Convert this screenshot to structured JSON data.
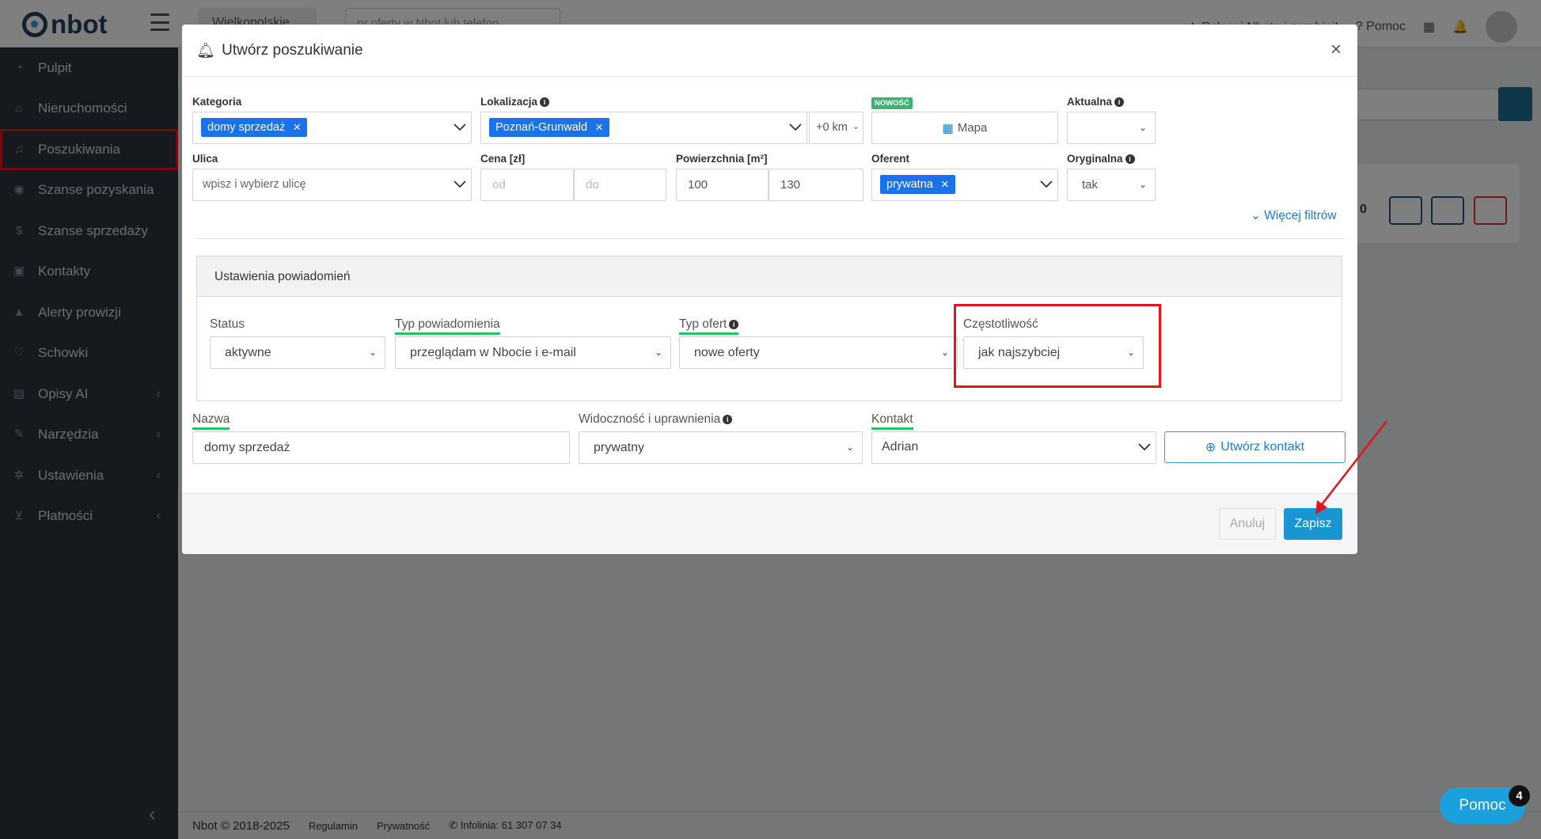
{
  "topbar": {
    "logo": "nbot",
    "region": "Wielkopolskie",
    "search_placeholder": "nr oferty w Nbot lub telefon",
    "referral": "Polecaj Nbota i zarabiaj!",
    "help": "Pomoc"
  },
  "sidebar": {
    "items": [
      {
        "label": "Pulpit",
        "icon": "dashboard-icon"
      },
      {
        "label": "Nieruchomości",
        "icon": "home-icon"
      },
      {
        "label": "Poszukiwania",
        "icon": "bell-icon"
      },
      {
        "label": "Szanse pozyskania",
        "icon": "eye-icon"
      },
      {
        "label": "Szanse sprzedaży",
        "icon": "dollar-icon"
      },
      {
        "label": "Kontakty",
        "icon": "contact-icon"
      },
      {
        "label": "Alerty prowizji",
        "icon": "warning-icon"
      },
      {
        "label": "Schowki",
        "icon": "heart-icon"
      },
      {
        "label": "Opisy AI",
        "icon": "comment-icon"
      },
      {
        "label": "Narzędzia",
        "icon": "wrench-icon"
      },
      {
        "label": "Ustawienia",
        "icon": "gear-icon"
      },
      {
        "label": "Płatności",
        "icon": "cart-icon"
      }
    ]
  },
  "modal": {
    "title": "Utwórz poszukiwanie",
    "filters": {
      "kategoria_label": "Kategoria",
      "kategoria_tag": "domy sprzedaż",
      "lokalizacja_label": "Lokalizacja",
      "lokalizacja_tag": "Poznań-Grunwald",
      "radius": "+0 km",
      "new_badge": "NOWOŚĆ",
      "map_button": "Mapa",
      "aktualna_label": "Aktualna",
      "ulica_label": "Ulica",
      "ulica_placeholder": "wpisz i wybierz ulicę",
      "cena_label": "Cena [zł]",
      "cena_od": "od",
      "cena_do": "do",
      "powierzchnia_label": "Powierzchnia [m²]",
      "powierzchnia_od": "100",
      "powierzchnia_do": "130",
      "oferent_label": "Oferent",
      "oferent_tag": "prywatna",
      "oryginalna_label": "Oryginalna",
      "oryginalna_value": "tak",
      "more_filters": "Więcej filtrów"
    },
    "notifications": {
      "heading": "Ustawienia powiadomień",
      "status_label": "Status",
      "status_value": "aktywne",
      "typ_label": "Typ powiadomienia",
      "typ_value": "przeglądam w Nbocie i e-mail",
      "typ_ofert_label": "Typ ofert",
      "typ_ofert_value": "nowe oferty",
      "czestotliwosc_label": "Częstotliwość",
      "czestotliwosc_value": "jak najszybciej"
    },
    "bottom": {
      "nazwa_label": "Nazwa",
      "nazwa_value": "domy sprzedaż",
      "widocznosc_label": "Widoczność i uprawnienia",
      "widocznosc_value": "prywatny",
      "kontakt_label": "Kontakt",
      "kontakt_value": "Adrian",
      "create_contact": "Utwórz kontakt"
    },
    "cancel": "Anuluj",
    "save": "Zapisz"
  },
  "footer": {
    "copyright": "Nbot © 2018-2025",
    "regulamin": "Regulamin",
    "privacy": "Prywatność",
    "hotline": "Infolinia: 61 307 07 34"
  },
  "help_widget": {
    "label": "Pomoc",
    "badge": "4"
  },
  "bg_card_count": "0",
  "colors": {
    "accent": "#1995d1",
    "tag": "#1a73e8",
    "highlight_red": "#e3141b",
    "underline_green": "#22c55e",
    "sidebar_bg": "#2c343f"
  }
}
